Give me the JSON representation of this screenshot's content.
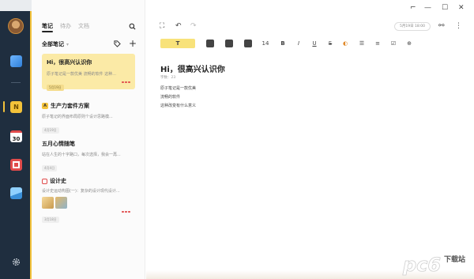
{
  "tabs": [
    "笔记",
    "待办",
    "文档"
  ],
  "list_header": "全部笔记",
  "notes": [
    {
      "title": "Hi，很高兴认识你",
      "preview": "原子笔记是一款优美 流畅的软件 这种...",
      "date": "5月19日"
    },
    {
      "title": "生产力套件方案",
      "preview": "原子笔记的界面布局原则个设计思路模...",
      "date": "4月19日"
    },
    {
      "title": "五月心情随笔",
      "preview": "站在人生的十字路口，每次选择，我会一再...",
      "date": "4月4日"
    },
    {
      "title": "设计史",
      "preview": "设计史运动构图(一)：复杂的设计现代设计...",
      "date": "3月18日"
    }
  ],
  "editor": {
    "date_pill": "5月19日 18:00",
    "toolbar_heading": "T",
    "toolbar_size": "14",
    "toolbar_bold": "B",
    "toolbar_italic": "I",
    "toolbar_underline": "U",
    "toolbar_strike": "S",
    "doc_title": "Hi，很高兴认识你",
    "doc_meta": "字数：23",
    "lines": [
      "原子笔记是一款优美",
      "流畅的软件",
      "这种改变有什么意义"
    ]
  },
  "watermark": "下载站",
  "colors": {
    "accent": "#f3c23a",
    "rail": "#1f2e3f",
    "selected_note": "#fbeaa6",
    "marker": "#e14b4b"
  }
}
